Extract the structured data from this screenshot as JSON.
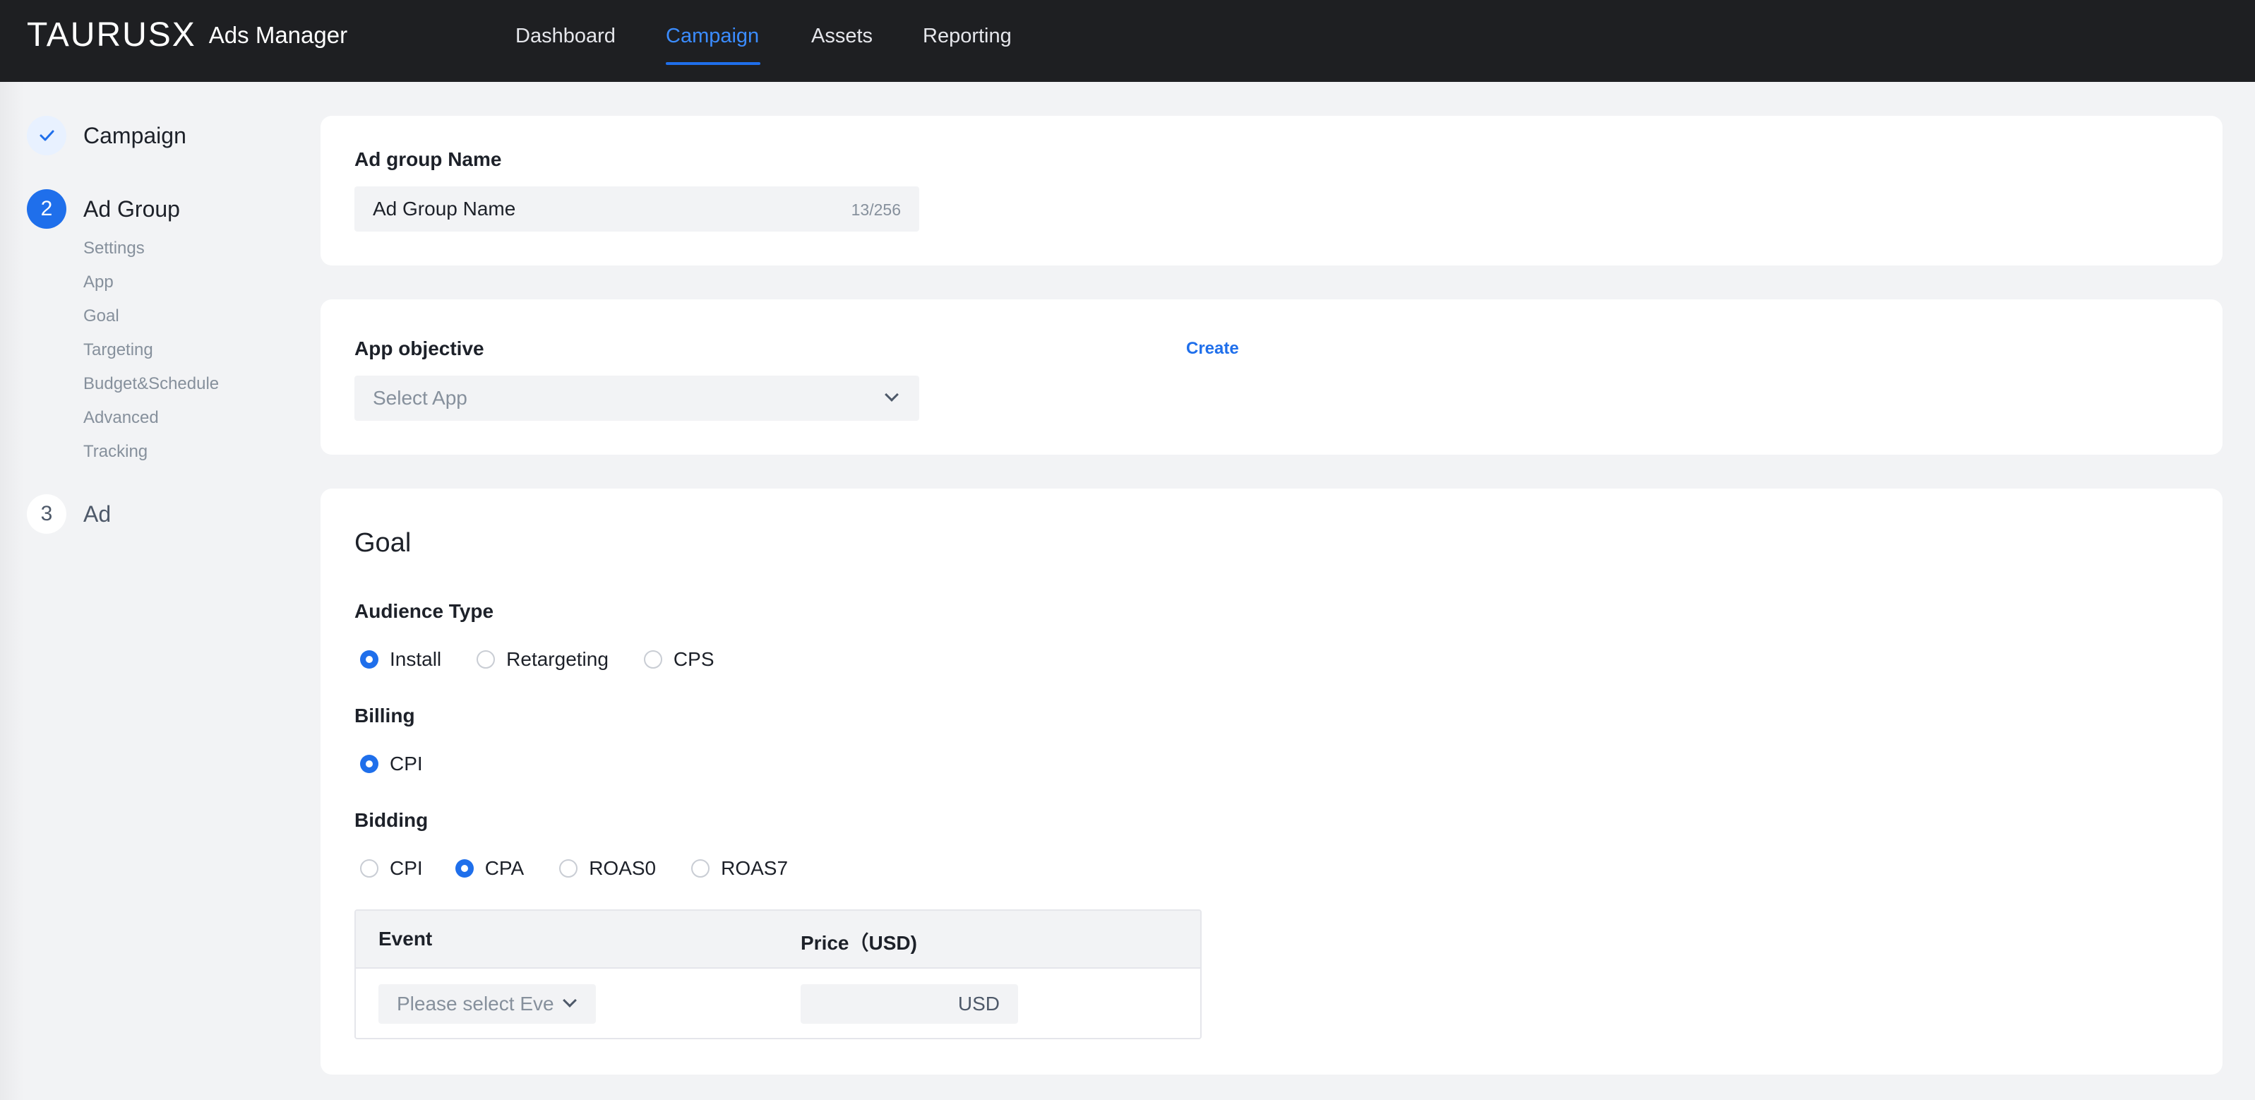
{
  "app": {
    "brand": "TAURUSX",
    "product": "Ads Manager"
  },
  "nav": {
    "items": [
      {
        "label": "Dashboard",
        "active": false
      },
      {
        "label": "Campaign",
        "active": true
      },
      {
        "label": "Assets",
        "active": false
      },
      {
        "label": "Reporting",
        "active": false
      }
    ]
  },
  "sidebar": {
    "steps": [
      {
        "number": "",
        "status": "done",
        "label": "Campaign"
      },
      {
        "number": "2",
        "status": "current",
        "label": "Ad Group"
      },
      {
        "number": "3",
        "status": "todo",
        "label": "Ad"
      }
    ],
    "substeps": [
      "Settings",
      "App",
      "Goal",
      "Targeting",
      "Budget&Schedule",
      "Advanced",
      "Tracking"
    ]
  },
  "ad_group_name": {
    "label": "Ad group Name",
    "value": "Ad Group Name",
    "counter": "13/256"
  },
  "app_objective": {
    "label": "App objective",
    "create_label": "Create",
    "placeholder": "Select App"
  },
  "goal": {
    "title": "Goal",
    "audience_type": {
      "label": "Audience Type",
      "options": [
        {
          "label": "Install",
          "checked": true
        },
        {
          "label": "Retargeting",
          "checked": false
        },
        {
          "label": "CPS",
          "checked": false
        }
      ]
    },
    "billing": {
      "label": "Billing",
      "options": [
        {
          "label": "CPI",
          "checked": true
        }
      ]
    },
    "bidding": {
      "label": "Bidding",
      "options": [
        {
          "label": "CPI",
          "checked": false
        },
        {
          "label": "CPA",
          "checked": true
        },
        {
          "label": "ROAS0",
          "checked": false
        },
        {
          "label": "ROAS7",
          "checked": false
        }
      ]
    },
    "event_table": {
      "headers": [
        "Event",
        "Price（USD)"
      ],
      "event_placeholder": "Please select Event",
      "price_unit": "USD"
    }
  },
  "colors": {
    "accent": "#1f6feb",
    "topbar": "#1e1f22",
    "page_bg": "#f2f3f5"
  },
  "icons": {
    "done_step": "check-icon",
    "dropdown": "chevron-down-icon"
  }
}
